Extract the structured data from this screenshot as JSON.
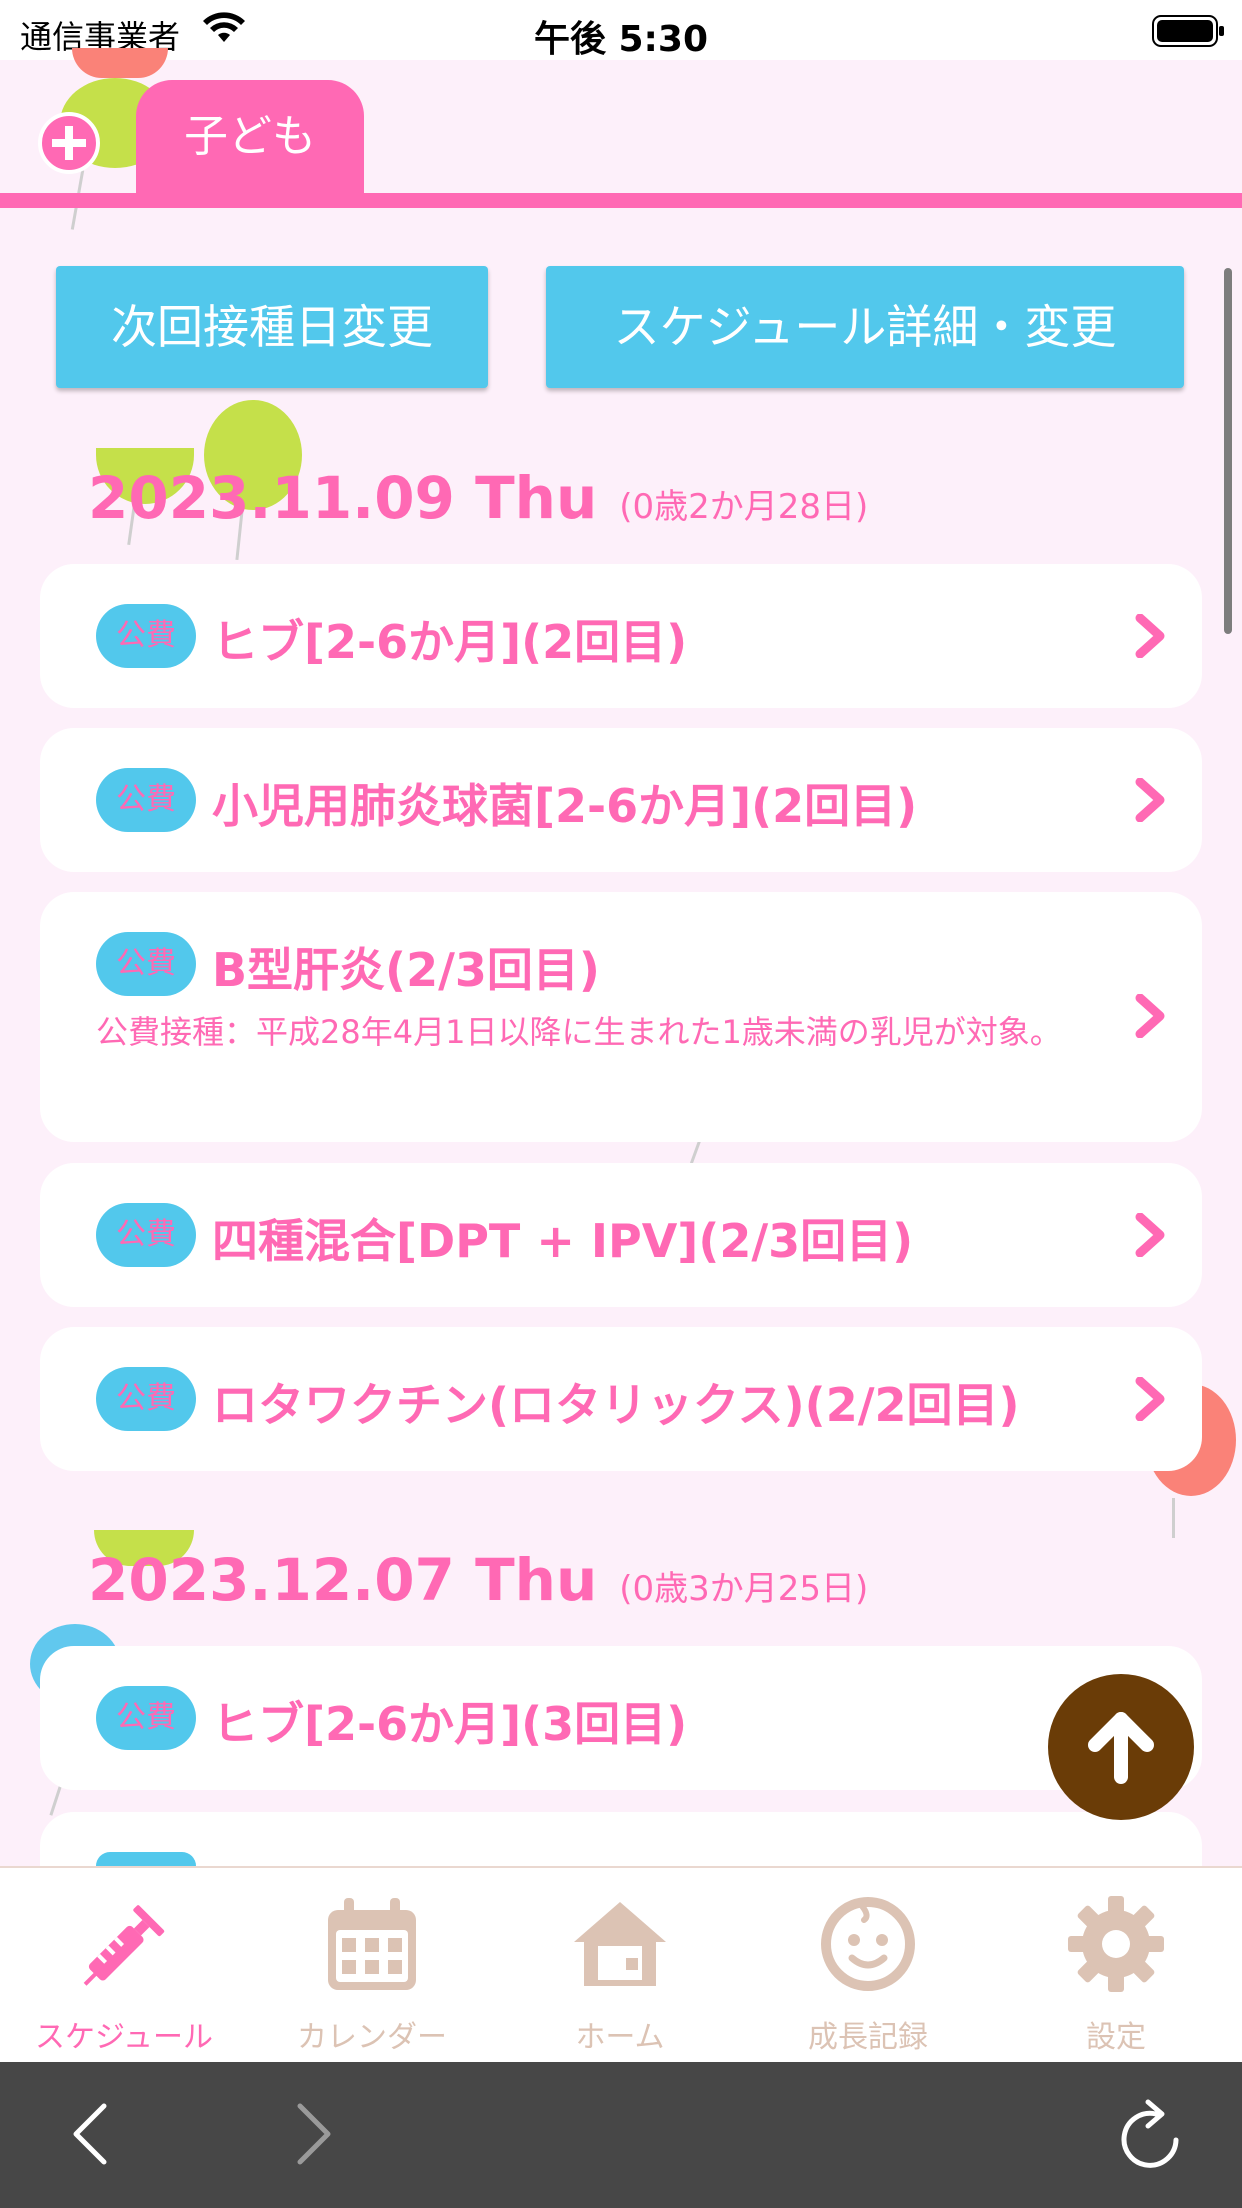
{
  "status_bar": {
    "carrier": "通信事業者",
    "time": "午後 5:30"
  },
  "header": {
    "child_tab_label": "子ども"
  },
  "actions": {
    "next_date_label": "次回接種日変更",
    "schedule_detail_label": "スケジュール詳細・変更"
  },
  "schedule": [
    {
      "date": "2023.11.09 Thu",
      "age": "(0歳2か月28日)",
      "items": [
        {
          "badge": "公費",
          "title": "ヒブ[2-6か月](2回目)"
        },
        {
          "badge": "公費",
          "title": "小児用肺炎球菌[2-6か月](2回目)"
        },
        {
          "badge": "公費",
          "title": "B型肝炎(2/3回目)",
          "note": "公費接種：平成28年4月1日以降に生まれた1歳未満の乳児が対象。"
        },
        {
          "badge": "公費",
          "title": "四種混合[DPT + IPV](2/3回目)"
        },
        {
          "badge": "公費",
          "title": "ロタワクチン(ロタリックス)(2/2回目)"
        }
      ]
    },
    {
      "date": "2023.12.07 Thu",
      "age": "(0歳3か月25日)",
      "items": [
        {
          "badge": "公費",
          "title": "ヒブ[2-6か月](3回目)"
        }
      ]
    }
  ],
  "bottom_nav": {
    "items": [
      {
        "label": "スケジュール",
        "icon": "syringe-icon",
        "active": true
      },
      {
        "label": "カレンダー",
        "icon": "calendar-icon",
        "active": false
      },
      {
        "label": "ホーム",
        "icon": "home-icon",
        "active": false
      },
      {
        "label": "成長記録",
        "icon": "baby-face-icon",
        "active": false
      },
      {
        "label": "設定",
        "icon": "gear-icon",
        "active": false
      }
    ]
  },
  "colors": {
    "accent_pink": "#ff69b4",
    "badge_blue": "#52c8ec",
    "up_button_brown": "#6a3c07",
    "inactive_nav": "#dcc3b4"
  }
}
